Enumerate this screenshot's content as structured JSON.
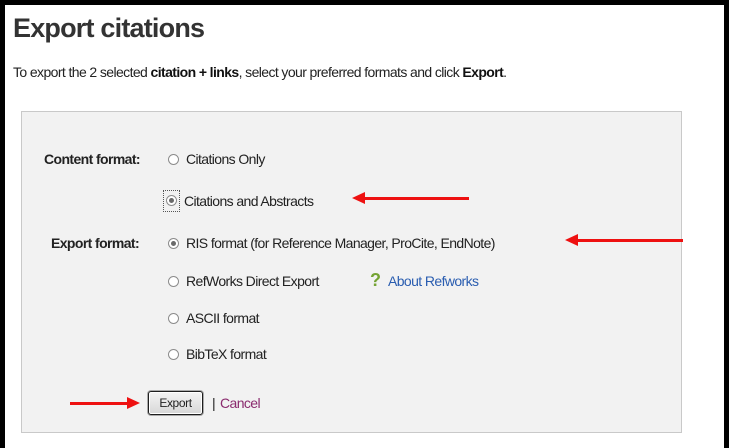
{
  "title": "Export citations",
  "intro": {
    "part1": "To export the 2 selected ",
    "bold1": "citation + links",
    "part2": ", select your preferred formats and click ",
    "bold2": "Export",
    "part3": "."
  },
  "content_format": {
    "label": "Content format:",
    "options": [
      {
        "label": "Citations Only",
        "selected": false
      },
      {
        "label": "Citations and Abstracts",
        "selected": true
      }
    ]
  },
  "export_format": {
    "label": "Export format:",
    "options": [
      {
        "label": "RIS format (for Reference Manager, ProCite, EndNote)",
        "selected": true
      },
      {
        "label": "RefWorks Direct Export",
        "selected": false
      },
      {
        "label": "ASCII format",
        "selected": false
      },
      {
        "label": "BibTeX format",
        "selected": false
      }
    ],
    "help_icon": "?",
    "about_link": "About Refworks"
  },
  "actions": {
    "export_label": "Export",
    "separator": "|",
    "cancel_label": "Cancel"
  },
  "colors": {
    "arrow": "#ee1111",
    "link": "#2a5db0",
    "cancel": "#8b2c6f",
    "help": "#74a333"
  }
}
